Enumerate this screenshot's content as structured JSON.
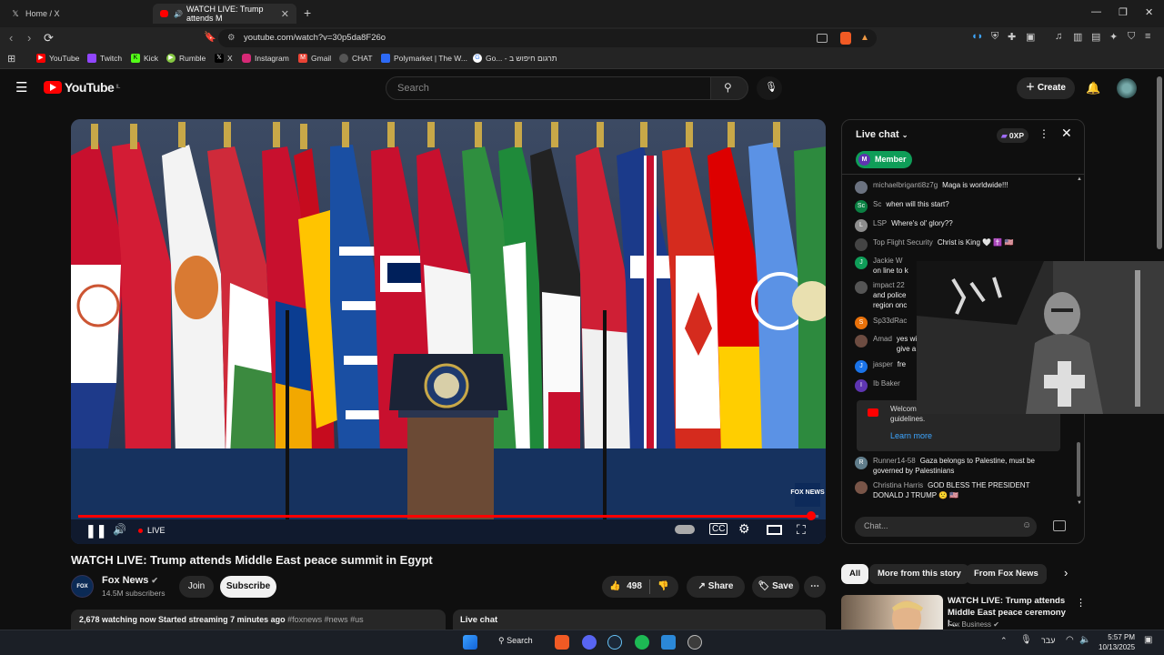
{
  "browser": {
    "tabs": [
      {
        "title": "Home / X"
      },
      {
        "title": "WATCH LIVE: Trump attends M"
      }
    ],
    "url": "youtube.com/watch?v=30p5da8F26o",
    "bookmarks": [
      "YouTube",
      "Twitch",
      "Kick",
      "Rumble",
      "X",
      "Instagram",
      "Gmail",
      "CHAT",
      "Polymarket | The W...",
      "Go... - חיפוש ב",
      "תרגום"
    ]
  },
  "youtube": {
    "logo_text": "YouTube",
    "logo_region": "IL",
    "search_placeholder": "Search",
    "create_label": "Create"
  },
  "player": {
    "live_label": "LIVE",
    "progress_fraction": 0.99,
    "watermark": "FOX NEWS"
  },
  "video": {
    "title": "WATCH LIVE: Trump attends Middle East peace summit in Egypt",
    "channel": "Fox News",
    "subscribers": "14.5M subscribers",
    "join_label": "Join",
    "subscribe_label": "Subscribe",
    "likes": "498",
    "share_label": "Share",
    "save_label": "Save",
    "watching": "2,678 watching now",
    "started": "Started streaming 7 minutes ago",
    "hashtags": "#foxnews #news #us",
    "live_chat_tab": "Live chat"
  },
  "chat": {
    "header": "Live chat",
    "xp": "0XP",
    "member_label": "Member",
    "messages": [
      {
        "author": "michaelbriganti8z7g",
        "text": "Maga is worldwide!!!",
        "color": "#6b7280",
        "initial": ""
      },
      {
        "author": "Sc",
        "text": "when will this start?",
        "color": "#0b8043",
        "initial": "Sc"
      },
      {
        "author": "LSP",
        "text": "Where's ol' glory??",
        "color": "#8d8d8d",
        "initial": "L"
      },
      {
        "author": "Top Flight Security",
        "text": "Christ is King 🤍 ✝️ 🇺🇸",
        "color": "#444",
        "initial": ""
      },
      {
        "author": "Jackie W",
        "text": "on line to k",
        "color": "#0f9d58",
        "initial": "J"
      },
      {
        "author": "impact 22",
        "text": "and police region onc",
        "color": "#555",
        "initial": ""
      },
      {
        "author": "Sp33dRac",
        "text": "",
        "color": "#e8710a",
        "initial": "S"
      },
      {
        "author": "Amad",
        "text": "yes will give a",
        "color": "#6d4c41",
        "initial": ""
      },
      {
        "author": "jasper",
        "text": "fre",
        "color": "#1a73e8",
        "initial": "J"
      },
      {
        "author": "Ib Baker",
        "text": "",
        "color": "#5e35b1",
        "initial": "I"
      }
    ],
    "welcome_text": "Welcom privacy and abide by our community guidelines.",
    "learn_more": "Learn more",
    "bottom_messages": [
      {
        "author": "Runner14-58",
        "text": "Gaza belongs to Palestine, must be governed by Palestinians",
        "color": "#607d8b",
        "initial": "R"
      },
      {
        "author": "Christina Harris",
        "text": "GOD BLESS THE PRESIDENT DONALD J TRUMP 🙁 🇺🇸",
        "color": "#795548",
        "initial": ""
      }
    ],
    "input_placeholder": "Chat..."
  },
  "related": {
    "chips": [
      "All",
      "More from this story",
      "From Fox News"
    ],
    "item_title": "WATCH LIVE: Trump attends Middle East peace ceremony I...",
    "item_channel": "Fox Business"
  },
  "taskbar": {
    "search_label": "Search",
    "lang": "עבר",
    "time": "5:57 PM",
    "date": "10/13/2025"
  },
  "colors": {
    "youtube_red": "#ff0000",
    "member_green": "#0f9d58",
    "link_blue": "#3ea6ff"
  }
}
